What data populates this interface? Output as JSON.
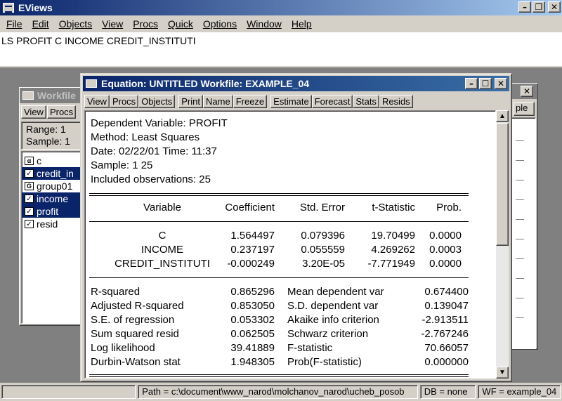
{
  "app": {
    "title": "EViews"
  },
  "menu": [
    "File",
    "Edit",
    "Objects",
    "View",
    "Procs",
    "Quick",
    "Options",
    "Window",
    "Help"
  ],
  "command": {
    "text": "LS  PROFIT C INCOME CREDIT_INSTITUTI"
  },
  "workfile": {
    "title": "Workfile",
    "toolbar": [
      "View",
      "Procs"
    ],
    "range_label": "Range:  1",
    "sample_label": "Sample: 1",
    "objects": [
      {
        "name": "c",
        "icon": "coef-icon",
        "selected": false
      },
      {
        "name": "credit_in",
        "icon": "series-icon",
        "selected": true
      },
      {
        "name": "group01",
        "icon": "group-icon",
        "selected": false
      },
      {
        "name": "income",
        "icon": "series-icon",
        "selected": true
      },
      {
        "name": "profit",
        "icon": "series-icon",
        "selected": true
      },
      {
        "name": "resid",
        "icon": "series-icon",
        "selected": false
      }
    ]
  },
  "back_window": {
    "tool_text": "ple"
  },
  "equation": {
    "title": "Equation: UNTITLED   Workfile: EXAMPLE_04",
    "toolbar_group1": [
      "View",
      "Procs",
      "Objects"
    ],
    "toolbar_group2": [
      "Print",
      "Name",
      "Freeze"
    ],
    "toolbar_group3": [
      "Estimate",
      "Forecast",
      "Stats",
      "Resids"
    ],
    "header": [
      "Dependent Variable: PROFIT",
      "Method: Least Squares",
      "Date: 02/22/01   Time: 11:37",
      "Sample: 1 25",
      "Included observations: 25"
    ],
    "columns": [
      "Variable",
      "Coefficient",
      "Std. Error",
      "t-Statistic",
      "Prob."
    ],
    "rows": [
      [
        "C",
        "1.564497",
        "0.079396",
        "19.70499",
        "0.0000"
      ],
      [
        "INCOME",
        "0.237197",
        "0.055559",
        "4.269262",
        "0.0003"
      ],
      [
        "CREDIT_INSTITUTI",
        "-0.000249",
        "3.20E-05",
        "-7.771949",
        "0.0000"
      ]
    ],
    "stats": [
      [
        "R-squared",
        "0.865296",
        "Mean dependent var",
        "0.674400"
      ],
      [
        "Adjusted R-squared",
        "0.853050",
        "S.D. dependent var",
        "0.139047"
      ],
      [
        "S.E. of regression",
        "0.053302",
        "Akaike info criterion",
        "-2.913511"
      ],
      [
        "Sum squared resid",
        "0.062505",
        "Schwarz criterion",
        "-2.767246"
      ],
      [
        "Log likelihood",
        "39.41889",
        "F-statistic",
        "70.66057"
      ],
      [
        "Durbin-Watson stat",
        "1.948305",
        "Prob(F-statistic)",
        "0.000000"
      ]
    ]
  },
  "status": {
    "path": "Path = c:\\document\\www_narod\\molchanov_narod\\ucheb_posob",
    "db": "DB = none",
    "wf": "WF = example_04"
  }
}
